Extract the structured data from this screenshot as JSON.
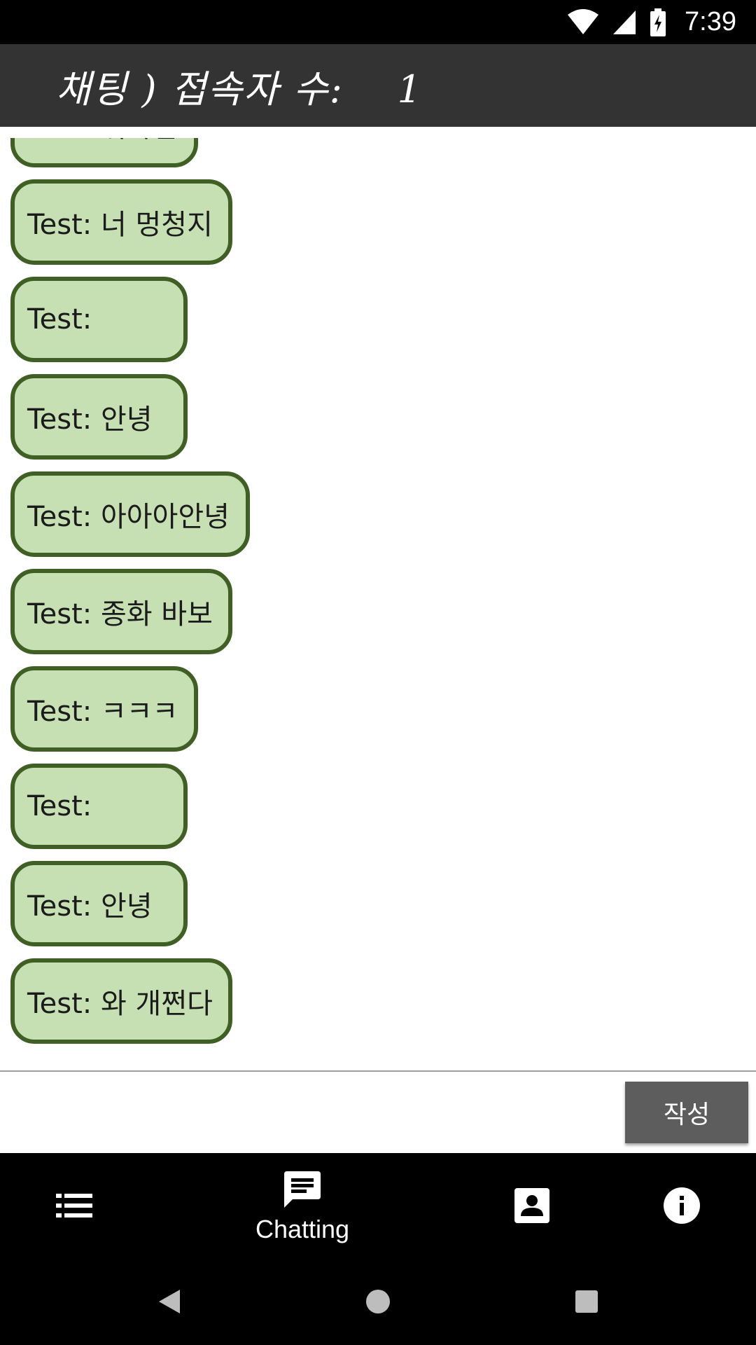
{
  "status_bar": {
    "time": "7:39",
    "icons": [
      "wifi-icon",
      "cell-signal-icon",
      "battery-charging-icon"
    ]
  },
  "header": {
    "title": "채팅 ) 접속자 수:    1"
  },
  "messages": [
    {
      "text": "Test: 뭐하심"
    },
    {
      "text": "Test: 너 멍청지"
    },
    {
      "text": "Test:"
    },
    {
      "text": "Test: 안녕"
    },
    {
      "text": "Test: 아아아안녕"
    },
    {
      "text": "Test: 종화 바보"
    },
    {
      "text": "Test: ㅋㅋㅋ"
    },
    {
      "text": "Test:"
    },
    {
      "text": "Test: 안녕"
    },
    {
      "text": "Test: 와 개쩐다"
    }
  ],
  "composer": {
    "input_value": "",
    "placeholder": "",
    "send_label": "작성"
  },
  "bottom_nav": {
    "items": [
      {
        "icon": "list-icon",
        "label": ""
      },
      {
        "icon": "chat-icon",
        "label": "Chatting"
      },
      {
        "icon": "contact-icon",
        "label": ""
      },
      {
        "icon": "info-icon",
        "label": ""
      }
    ],
    "active": "Chatting"
  },
  "system_nav": [
    "back-icon",
    "home-icon",
    "recents-icon"
  ],
  "colors": {
    "bubble_fill": "#c6e0b4",
    "bubble_border": "#3f5f25",
    "title_bar": "#333333",
    "send_button": "#5d5d5d"
  }
}
